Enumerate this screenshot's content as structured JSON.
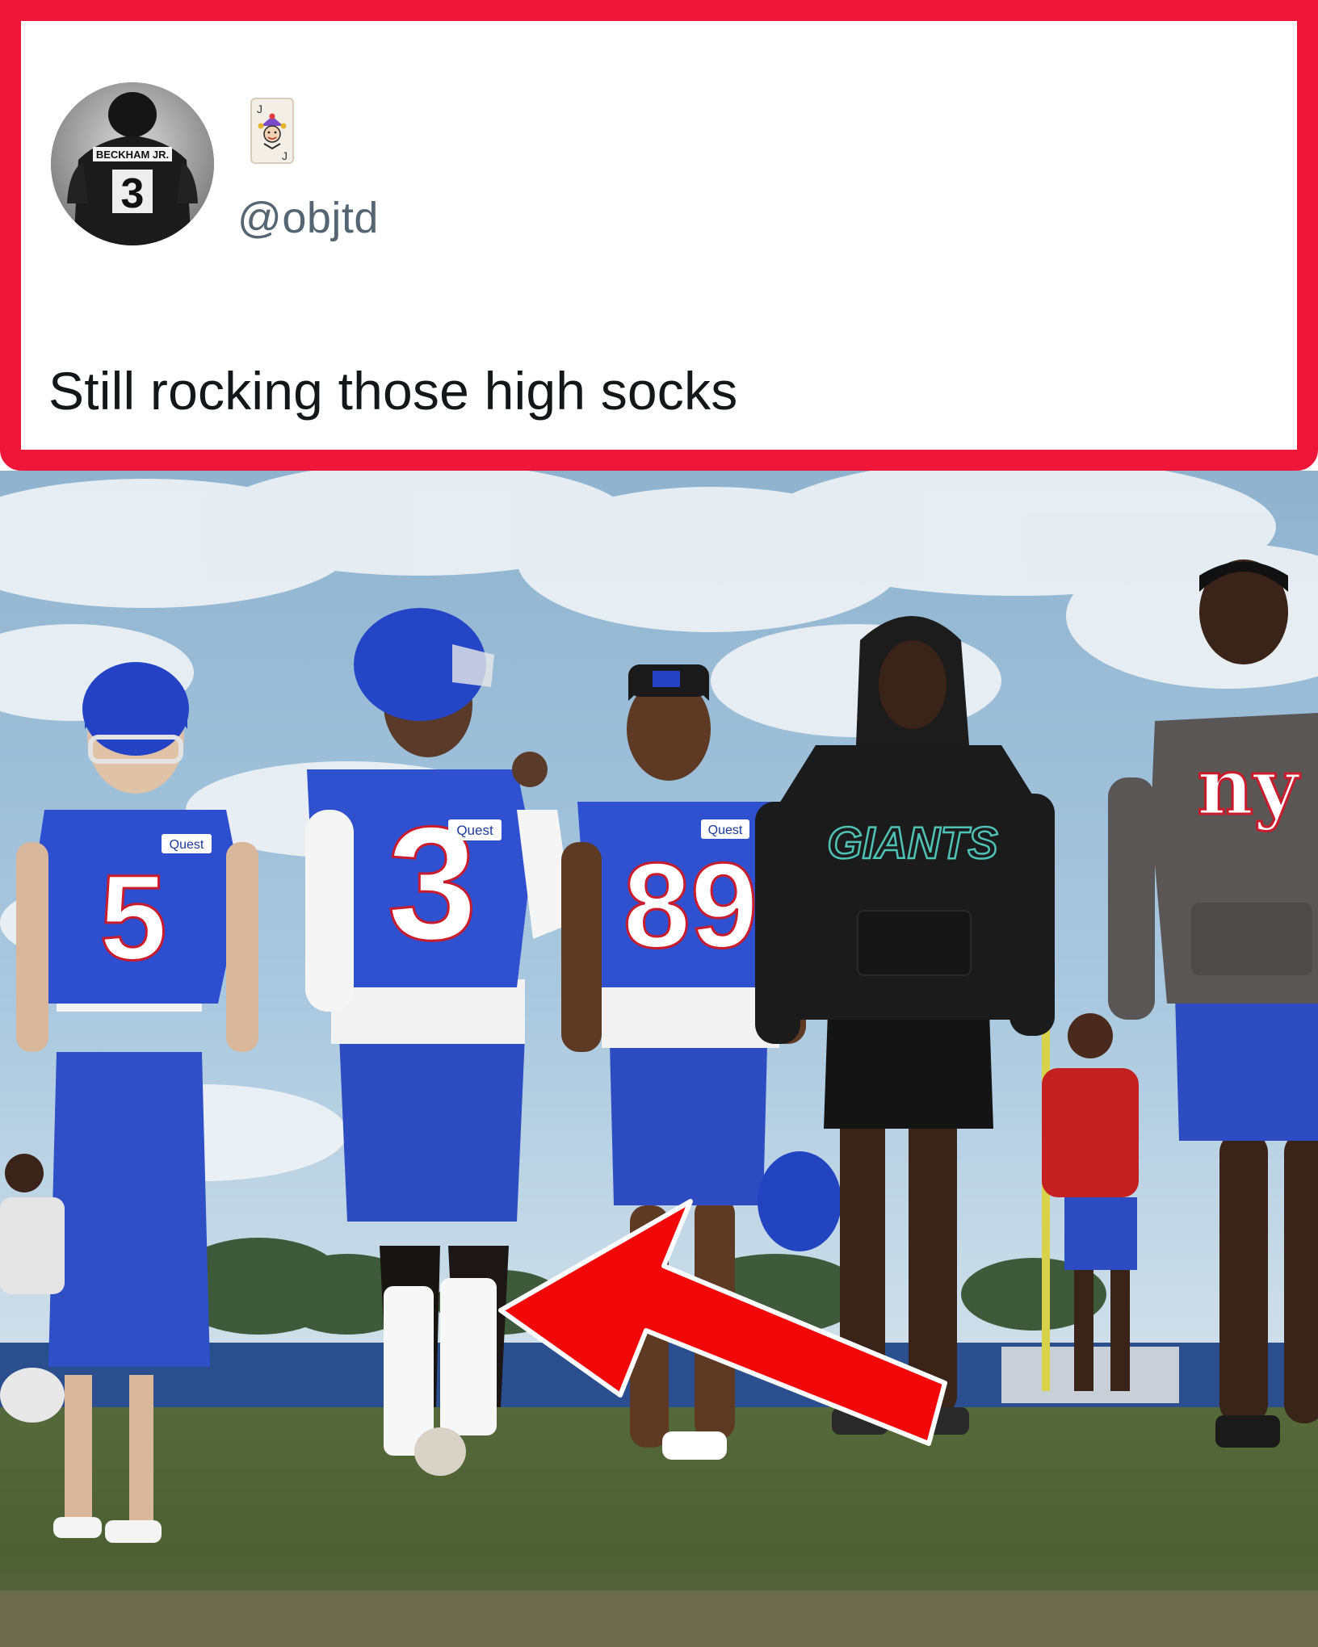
{
  "post": {
    "author_handle": "@objtd",
    "author_badge_icon": "joker-card-icon",
    "avatar_jersey_name": "BECKHAM JR.",
    "avatar_jersey_number": "3",
    "text": "Still rocking those high socks"
  },
  "photo": {
    "jerseys": {
      "player_left_number": "5",
      "player_center_number": "3",
      "player_right_number": "89",
      "sponsor_patch": "Quest"
    },
    "hoodie_black_text": "GIANTS",
    "hoodie_gray_logo": "ny",
    "annotation": "red-arrow-icon"
  },
  "colors": {
    "frame_border": "#f0163a",
    "handle_text": "#556573",
    "giants_blue": "#1f3fc2",
    "arrow_red": "#f20808"
  }
}
